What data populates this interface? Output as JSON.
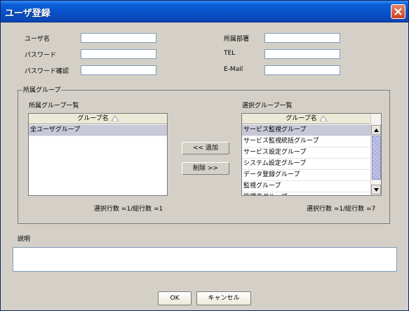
{
  "window": {
    "title": "ユーザ登録"
  },
  "form": {
    "username_label": "ユーザ名",
    "username_value": "",
    "password_label": "パスワード",
    "password_value": "",
    "password_confirm_label": "パスワード確認",
    "password_confirm_value": "",
    "department_label": "所属部署",
    "department_value": "",
    "tel_label": "TEL",
    "tel_value": "",
    "email_label": "E-Mail",
    "email_value": ""
  },
  "groups": {
    "legend": "所属グループ",
    "left_title": "所属グループ一覧",
    "right_title": "選択グループ一覧",
    "column_header": "グループ名",
    "left_items": [
      "全ユーザグループ"
    ],
    "right_items": [
      "サービス監視グループ",
      "サービス監視統括グループ",
      "サービス設定グループ",
      "システム設定グループ",
      "データ登録グループ",
      "監視グループ",
      "管理者グループ"
    ],
    "add_button": "<< 追加",
    "remove_button": "削除 >>",
    "left_status": "選択行数 =1/総行数 =1",
    "right_status": "選択行数 =1/総行数 =7"
  },
  "description": {
    "label": "説明",
    "value": ""
  },
  "footer": {
    "ok_label": "OK",
    "cancel_label": "キャンセル"
  }
}
